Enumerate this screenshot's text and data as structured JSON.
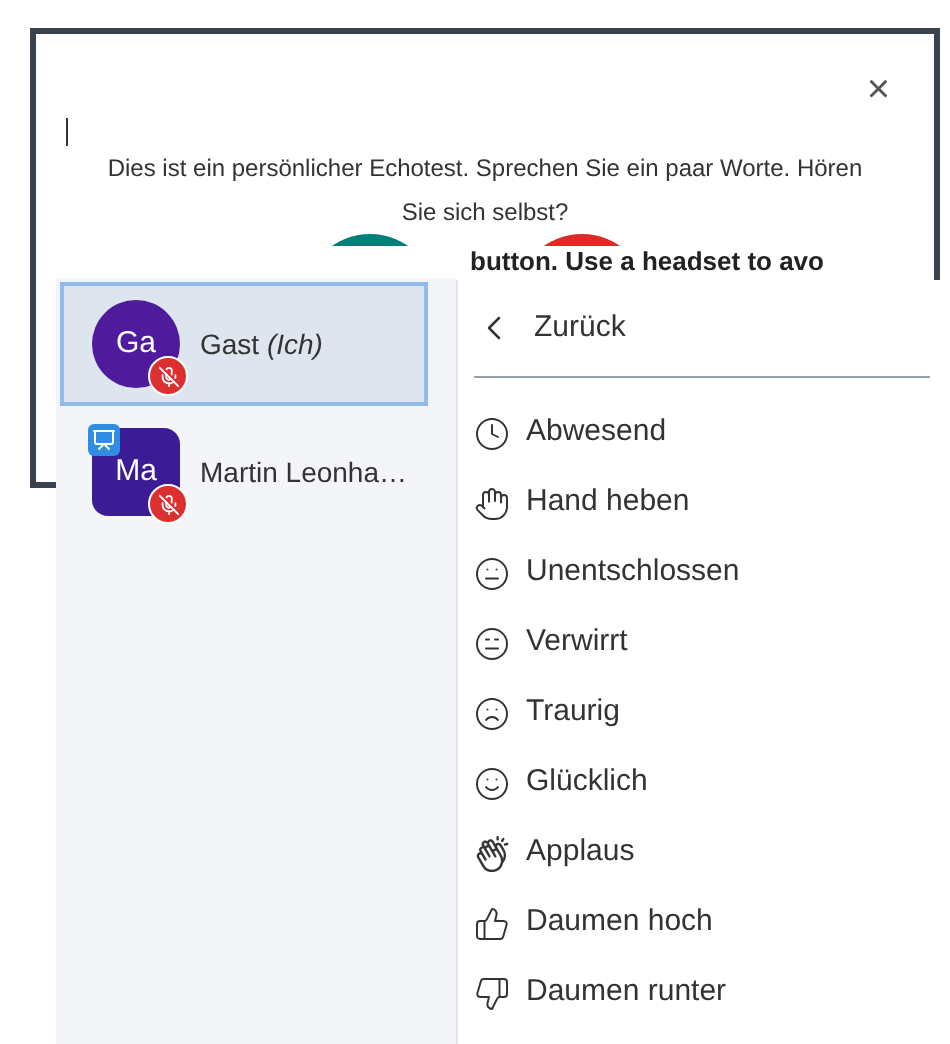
{
  "dialog": {
    "close_label": "×",
    "message": "Dies ist ein persönlicher Echotest. Sprechen Sie ein paar Worte. Hören Sie sich selbst?",
    "hint": "button. Use a headset to avo"
  },
  "participants": [
    {
      "initials": "Ga",
      "name": "Gast *(Ich)*",
      "moderator": false,
      "presenter": false,
      "muted": true,
      "selected": true
    },
    {
      "initials": "Ma",
      "name": "Martin Leonha…",
      "moderator": true,
      "presenter": true,
      "muted": true,
      "selected": false
    }
  ],
  "menu": {
    "back": "Zurück",
    "items": [
      {
        "label": "Abwesend"
      },
      {
        "label": "Hand heben"
      },
      {
        "label": "Unentschlossen"
      },
      {
        "label": "Verwirrt"
      },
      {
        "label": "Traurig"
      },
      {
        "label": "Glücklich"
      },
      {
        "label": "Applaus"
      },
      {
        "label": "Daumen hoch"
      },
      {
        "label": "Daumen runter"
      }
    ]
  }
}
